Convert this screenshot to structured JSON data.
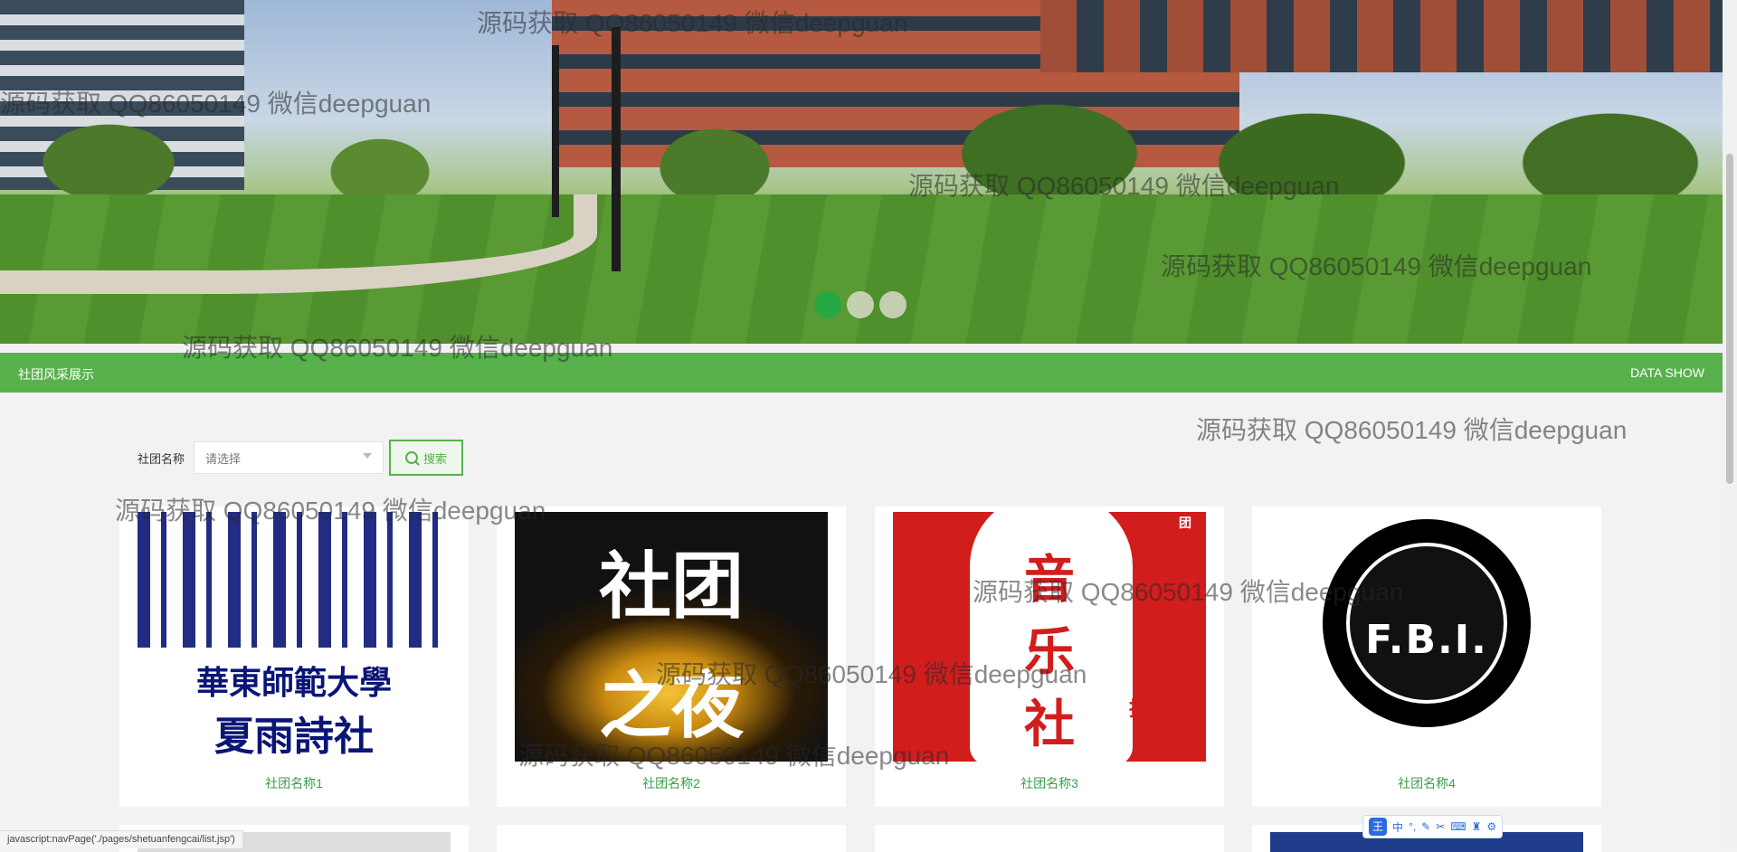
{
  "banner": {
    "dots": [
      {
        "label": "slide-1",
        "active": true
      },
      {
        "label": "slide-2",
        "active": false
      },
      {
        "label": "slide-3",
        "active": false
      }
    ]
  },
  "section": {
    "title": "社团风采展示",
    "more": "DATA SHOW"
  },
  "search": {
    "label": "社团名称",
    "placeholder": "请选择",
    "button": "搜索"
  },
  "clubs": [
    {
      "name": "社团名称1",
      "poster_text": [
        "華東師範大學",
        "夏雨詩社"
      ]
    },
    {
      "name": "社团名称2",
      "poster_text": [
        "社团",
        "之夜"
      ]
    },
    {
      "name": "社团名称3",
      "poster_text": [
        "音",
        "乐",
        "社",
        "招新",
        "团"
      ]
    },
    {
      "name": "社团名称4",
      "poster_text": [
        "F.B.I."
      ]
    }
  ],
  "watermark": "源码获取 QQ86050149 微信deepguan",
  "status_bar": "javascript:navPage('./pages/shetuanfengcai/list.jsp')",
  "ime": {
    "logo": "王",
    "mode": "中"
  },
  "colors": {
    "accent": "#58b14c",
    "link": "#3a9d4a",
    "dot_active": "#27a844"
  }
}
